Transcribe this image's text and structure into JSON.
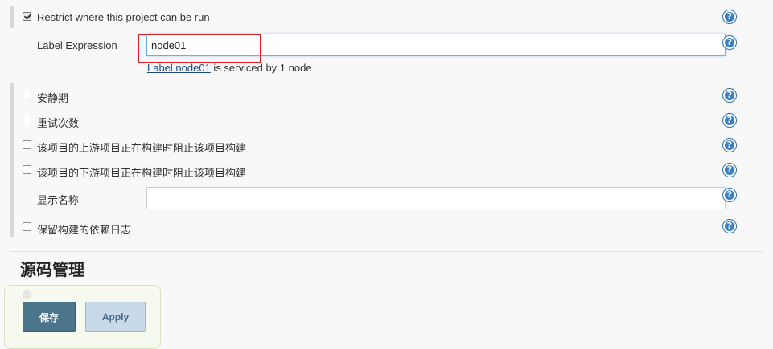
{
  "restrict": {
    "label": "Restrict where this project can be run",
    "checked": true
  },
  "label_expression": {
    "label": "Label Expression",
    "value": "node01",
    "status_link": "Label node01",
    "status_text": " is serviced by 1 node"
  },
  "options": [
    {
      "label": "安静期",
      "checked": false
    },
    {
      "label": "重试次数",
      "checked": false
    },
    {
      "label": "该项目的上游项目正在构建时阻止该项目构建",
      "checked": false
    },
    {
      "label": "该项目的下游项目正在构建时阻止该项目构建",
      "checked": false
    }
  ],
  "display_name": {
    "label": "显示名称",
    "value": ""
  },
  "keep_log": {
    "label": "保留构建的依赖日志",
    "checked": false
  },
  "section": {
    "title": "源码管理"
  },
  "buttons": {
    "save": "保存",
    "apply": "Apply"
  },
  "help_glyph": "?",
  "help_icon": "question-circle",
  "colors": {
    "highlight": "#e31e24",
    "save_button": "#4b758b",
    "apply_button": "#c8daea",
    "help": "#3b7fc4"
  }
}
